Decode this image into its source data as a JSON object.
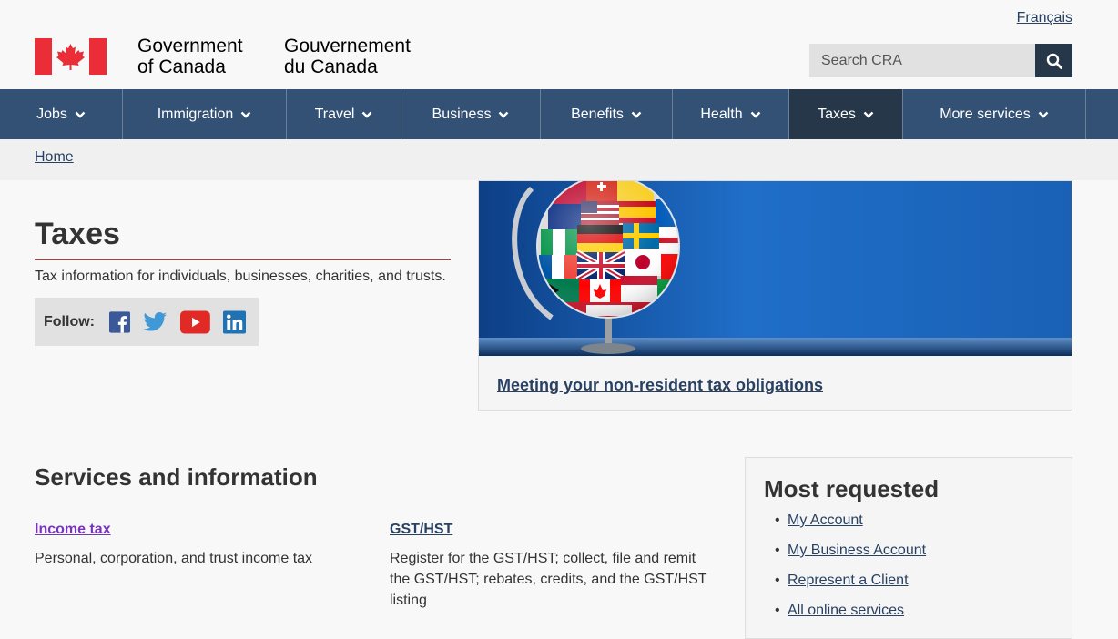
{
  "header": {
    "language_toggle": "Français",
    "signature_en": [
      "Government",
      "of Canada"
    ],
    "signature_fr": [
      "Gouvernement",
      "du Canada"
    ],
    "search_placeholder": "Search CRA"
  },
  "nav": {
    "items": [
      {
        "label": "Jobs",
        "active": false
      },
      {
        "label": "Immigration",
        "active": false
      },
      {
        "label": "Travel",
        "active": false
      },
      {
        "label": "Business",
        "active": false
      },
      {
        "label": "Benefits",
        "active": false
      },
      {
        "label": "Health",
        "active": false
      },
      {
        "label": "Taxes",
        "active": true
      },
      {
        "label": "More services",
        "active": false
      }
    ]
  },
  "breadcrumb": {
    "home": "Home"
  },
  "page": {
    "title": "Taxes",
    "lead": "Tax information for individuals, businesses, charities, and trusts.",
    "follow_label": "Follow:",
    "social": [
      "facebook-icon",
      "twitter-icon",
      "youtube-icon",
      "linkedin-icon"
    ]
  },
  "feature": {
    "link_text": "Meeting your non-resident tax obligations"
  },
  "services": {
    "heading": "Services and information",
    "items": [
      {
        "title": "Income tax",
        "desc": "Personal, corporation, and trust income tax",
        "visited": true
      },
      {
        "title": "GST/HST",
        "desc": "Register for the GST/HST; collect, file and remit the GST/HST; rebates, credits, and the GST/HST listing",
        "visited": false
      }
    ]
  },
  "most_requested": {
    "heading": "Most requested",
    "links": [
      "My Account",
      "My Business Account",
      "Represent a Client",
      "All online services"
    ]
  },
  "colors": {
    "nav_bg": "#335075",
    "nav_active": "#26374a",
    "link": "#284162",
    "visited": "#7834bc",
    "rule": "#af3c43",
    "flag_red": "#eb2d37"
  }
}
